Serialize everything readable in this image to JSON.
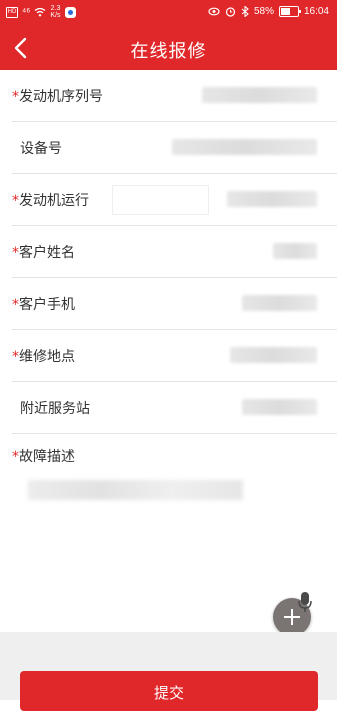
{
  "status_bar": {
    "hd": "HD",
    "signal": "⁴⁶",
    "speed_top": "2.3",
    "speed_bottom": "K/s",
    "battery": "58%",
    "time": "16:04"
  },
  "header": {
    "title": "在线报修"
  },
  "form": {
    "fields": [
      {
        "label": "发动机序列号",
        "required": true
      },
      {
        "label": "设备号",
        "required": false
      },
      {
        "label": "发动机运行",
        "required": true
      },
      {
        "label": "客户姓名",
        "required": true
      },
      {
        "label": "客户手机",
        "required": true
      },
      {
        "label": "维修地点",
        "required": true
      },
      {
        "label": "附近服务站",
        "required": false
      }
    ],
    "description_label": "故障描述",
    "required_mark": "*"
  },
  "submit_label": "提交",
  "colors": {
    "brand_red": "#e0272a",
    "fab_gray": "#7a7573"
  },
  "battery_level": 0.58
}
